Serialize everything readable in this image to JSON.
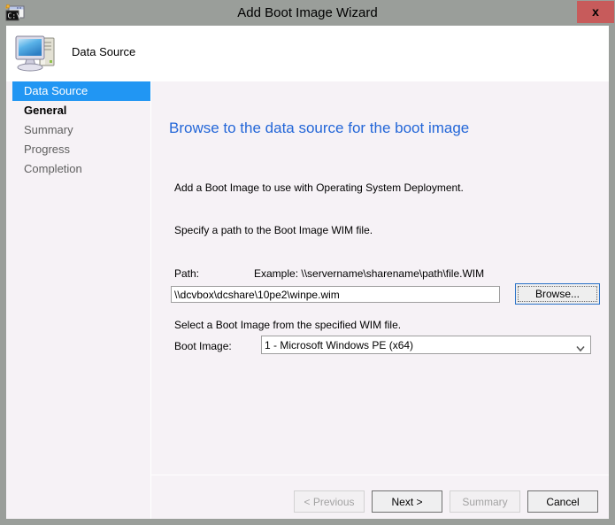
{
  "window": {
    "title": "Add Boot Image Wizard",
    "title_icon": "console-window-icon",
    "close_label": "x"
  },
  "header": {
    "icon": "computer-icon",
    "title": "Data Source"
  },
  "sidebar": {
    "items": [
      {
        "label": "Data Source",
        "state": "selected"
      },
      {
        "label": "General",
        "state": "visited"
      },
      {
        "label": "Summary",
        "state": "normal"
      },
      {
        "label": "Progress",
        "state": "normal"
      },
      {
        "label": "Completion",
        "state": "normal"
      }
    ]
  },
  "main": {
    "heading": "Browse to the data source for the boot image",
    "intro_line_1": "Add a Boot Image to use with Operating System Deployment.",
    "intro_line_2": "Specify a path to the Boot Image WIM file.",
    "path_label": "Path:",
    "path_example": "Example: \\\\servername\\sharename\\path\\file.WIM",
    "path_value": "\\\\dcvbox\\dcshare\\10pe2\\winpe.wim",
    "path_placeholder": "",
    "browse_label": "Browse...",
    "wim_note": "Select a Boot Image from the specified WIM file.",
    "bootimage_label": "Boot Image:",
    "bootimage_selected": "1 - Microsoft Windows PE (x64)",
    "bootimage_options": [
      "1 - Microsoft Windows PE (x64)"
    ],
    "select_arrow_icon": "chevron-down-icon"
  },
  "footer": {
    "previous_label": "< Previous",
    "next_label": "Next >",
    "summary_label": "Summary",
    "cancel_label": "Cancel"
  },
  "colors": {
    "titlebar": "#9a9e9a",
    "close_button": "#c75b5b",
    "content_bg": "#f6f2f6",
    "heading_blue": "#2467d8",
    "selection_blue": "#2196f3",
    "focus_border": "#2a72c8"
  }
}
